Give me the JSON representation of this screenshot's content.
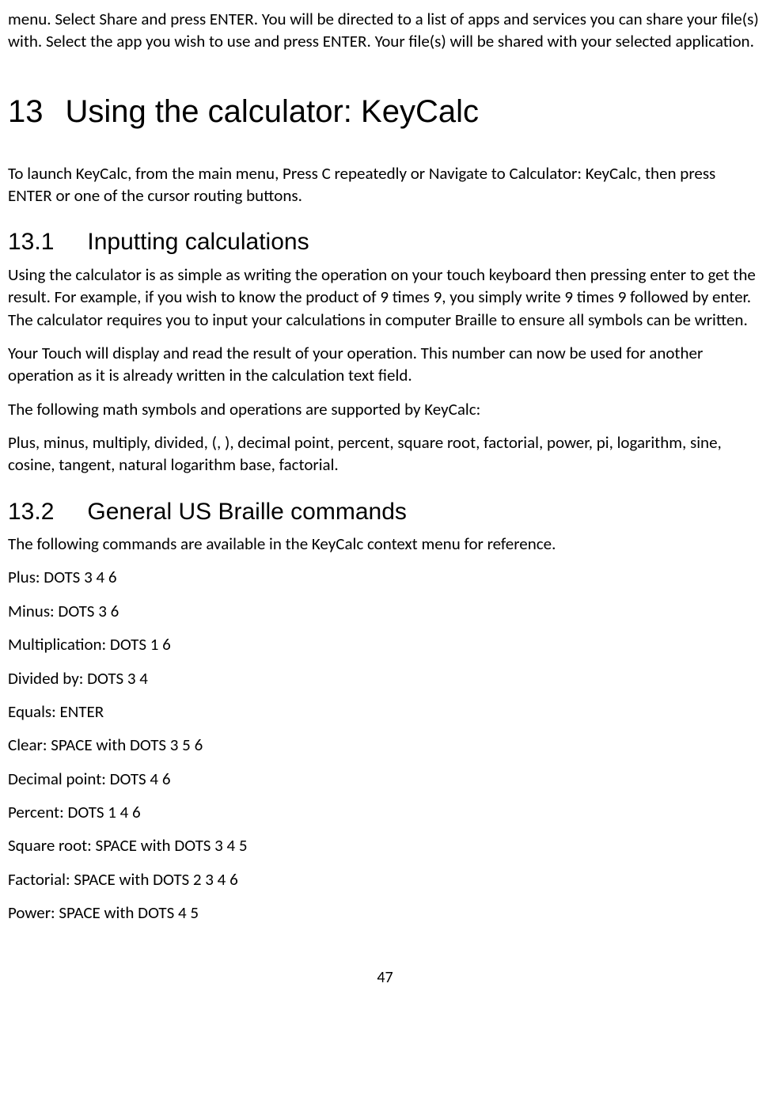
{
  "intro": "menu. Select Share and press ENTER. You will be directed to a list of apps and services you can share your file(s) with. Select the app you wish to use and press ENTER. Your file(s) will be shared with your selected application.",
  "h1": {
    "num": "13",
    "title": "Using the calculator: KeyCalc"
  },
  "p_launch": "To launch KeyCalc, from the main menu, Press C repeatedly or Navigate to Calculator: KeyCalc, then press ENTER or one of the cursor routing buttons.",
  "s1": {
    "num": "13.1",
    "title": "Inputting calculations"
  },
  "s1_p1": "Using the calculator is as simple as writing the operation on your touch keyboard then pressing enter to get the result. For example, if you wish to know the product of 9 times 9, you simply write 9 times 9 followed by enter. The calculator requires you to input your calculations in computer Braille to ensure all symbols can be written.",
  "s1_p2": "Your Touch will display and read the result of your operation. This number can now be used for another operation as it is already written in the calculation text field.",
  "s1_p3": "The following math symbols and operations are supported by KeyCalc:",
  "s1_p4": "Plus, minus, multiply, divided, (, ), decimal point, percent, square root, factorial, power, pi, logarithm, sine, cosine, tangent, natural logarithm base, factorial.",
  "s2": {
    "num": "13.2",
    "title": "General US Braille commands"
  },
  "s2_p1": "The following commands are available in the KeyCalc context menu for reference.",
  "commands": [
    "Plus: DOTS 3 4 6",
    "Minus: DOTS 3 6",
    "Multiplication: DOTS 1 6",
    "Divided by: DOTS 3 4",
    "Equals: ENTER",
    "Clear: SPACE with DOTS 3 5 6",
    "Decimal point: DOTS 4 6",
    "Percent: DOTS 1 4 6",
    "Square root: SPACE with DOTS 3 4 5",
    "Factorial: SPACE with DOTS 2 3 4 6",
    "Power: SPACE with DOTS 4 5"
  ],
  "page_num": "47"
}
